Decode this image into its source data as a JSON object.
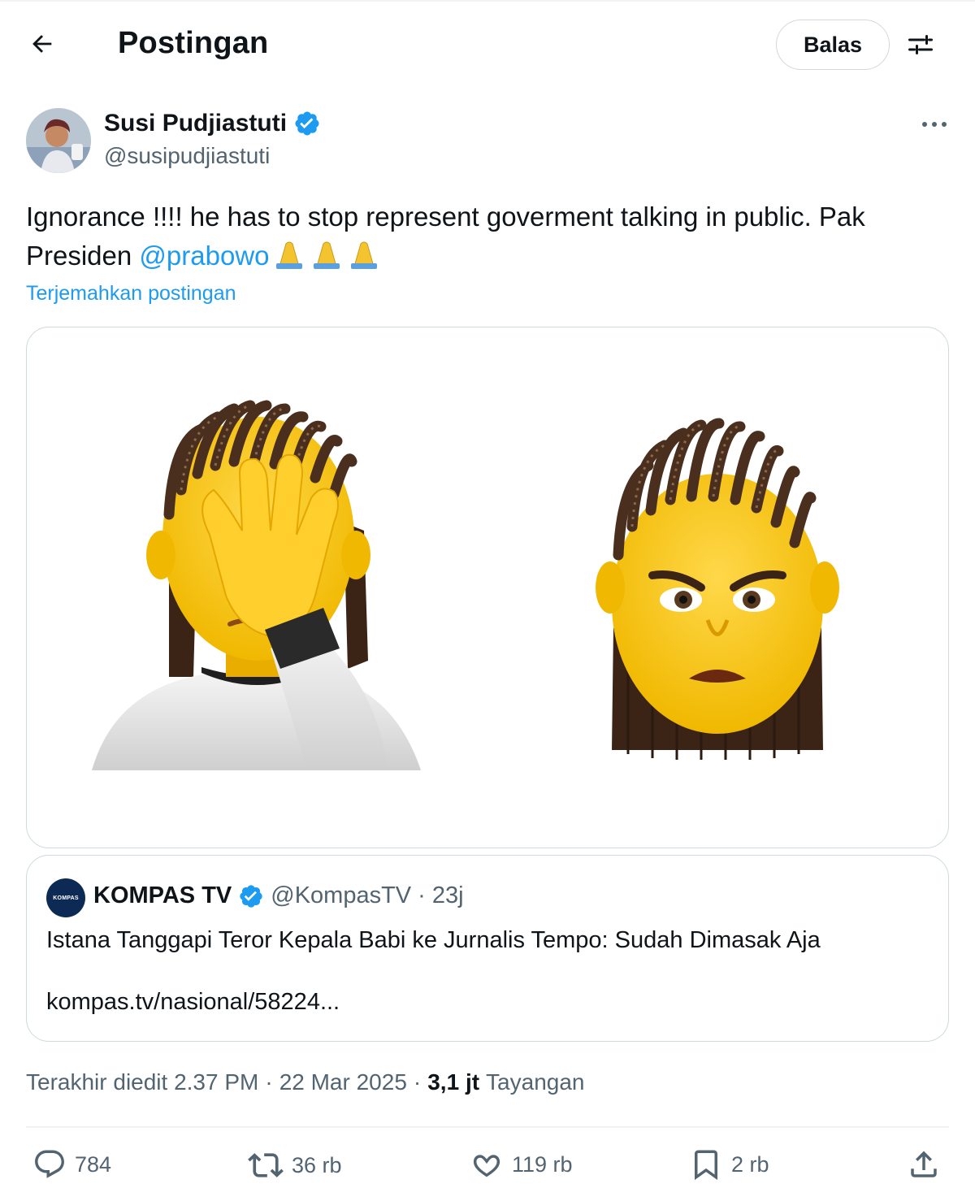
{
  "header": {
    "title": "Postingan",
    "reply_label": "Balas"
  },
  "author": {
    "name": "Susi Pudjiastuti",
    "handle": "@susipudjiastuti",
    "verified": true
  },
  "tweet": {
    "text_part1": "Ignorance !!!! he has to stop represent goverment talking in public. Pak Presiden ",
    "mention": "@prabowo",
    "emoji": "🙏🙏🙏",
    "translate_label": "Terjemahkan postingan"
  },
  "quote": {
    "avatar_text": "KOMPAS",
    "name": "KOMPAS TV",
    "handle": "@KompasTV",
    "separator": "·",
    "time": "23j",
    "text": "Istana Tanggapi Teror Kepala Babi ke Jurnalis Tempo: Sudah Dimasak Aja",
    "link": "kompas.tv/nasional/58224..."
  },
  "meta": {
    "edited": "Terakhir diedit 2.37 PM",
    "sep1": "·",
    "date": "22 Mar 2025",
    "sep2": "·",
    "views": "3,1 jt",
    "views_label": "Tayangan"
  },
  "actions": {
    "replies": "784",
    "reposts": "36 rb",
    "likes": "119 rb",
    "bookmarks": "2 rb"
  },
  "colors": {
    "accent": "#1d9bf0",
    "secondary_text": "#536471",
    "border": "#cfd9de",
    "emoji_skin": "#f5c518",
    "hair": "#4a2f1e"
  }
}
